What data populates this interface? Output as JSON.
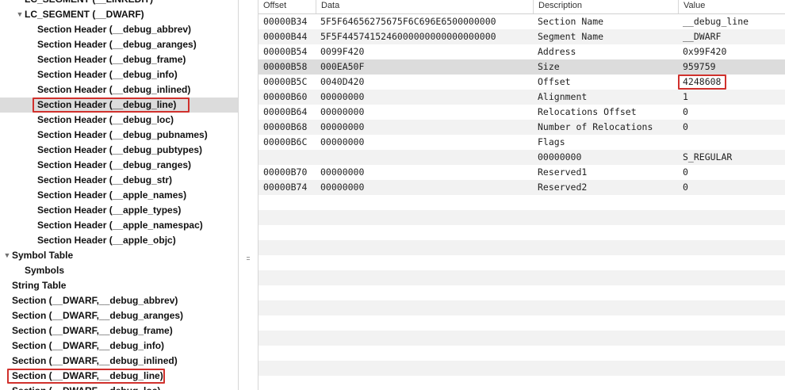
{
  "sidebar": {
    "items": [
      {
        "label": "LC_SEGMENT (__LINKEDIT)",
        "indent": 1,
        "disclosure": "none",
        "selected": false,
        "highlighted": false
      },
      {
        "label": "LC_SEGMENT (__DWARF)",
        "indent": 1,
        "disclosure": "expanded",
        "selected": false,
        "highlighted": false
      },
      {
        "label": "Section Header (__debug_abbrev)",
        "indent": 2,
        "disclosure": "none",
        "selected": false,
        "highlighted": false
      },
      {
        "label": "Section Header (__debug_aranges)",
        "indent": 2,
        "disclosure": "none",
        "selected": false,
        "highlighted": false
      },
      {
        "label": "Section Header (__debug_frame)",
        "indent": 2,
        "disclosure": "none",
        "selected": false,
        "highlighted": false
      },
      {
        "label": "Section Header (__debug_info)",
        "indent": 2,
        "disclosure": "none",
        "selected": false,
        "highlighted": false
      },
      {
        "label": "Section Header (__debug_inlined)",
        "indent": 2,
        "disclosure": "none",
        "selected": false,
        "highlighted": false
      },
      {
        "label": "Section Header (__debug_line)",
        "indent": 2,
        "disclosure": "none",
        "selected": true,
        "highlighted": true
      },
      {
        "label": "Section Header (__debug_loc)",
        "indent": 2,
        "disclosure": "none",
        "selected": false,
        "highlighted": false
      },
      {
        "label": "Section Header (__debug_pubnames)",
        "indent": 2,
        "disclosure": "none",
        "selected": false,
        "highlighted": false
      },
      {
        "label": "Section Header (__debug_pubtypes)",
        "indent": 2,
        "disclosure": "none",
        "selected": false,
        "highlighted": false
      },
      {
        "label": "Section Header (__debug_ranges)",
        "indent": 2,
        "disclosure": "none",
        "selected": false,
        "highlighted": false
      },
      {
        "label": "Section Header (__debug_str)",
        "indent": 2,
        "disclosure": "none",
        "selected": false,
        "highlighted": false
      },
      {
        "label": "Section Header (__apple_names)",
        "indent": 2,
        "disclosure": "none",
        "selected": false,
        "highlighted": false
      },
      {
        "label": "Section Header (__apple_types)",
        "indent": 2,
        "disclosure": "none",
        "selected": false,
        "highlighted": false
      },
      {
        "label": "Section Header (__apple_namespac)",
        "indent": 2,
        "disclosure": "none",
        "selected": false,
        "highlighted": false
      },
      {
        "label": "Section Header (__apple_objc)",
        "indent": 2,
        "disclosure": "none",
        "selected": false,
        "highlighted": false
      },
      {
        "label": "Symbol Table",
        "indent": 0,
        "disclosure": "expanded",
        "selected": false,
        "highlighted": false
      },
      {
        "label": "Symbols",
        "indent": 1,
        "disclosure": "none",
        "selected": false,
        "highlighted": false
      },
      {
        "label": "String Table",
        "indent": 0,
        "disclosure": "none",
        "selected": false,
        "highlighted": false
      },
      {
        "label": "Section (__DWARF,__debug_abbrev)",
        "indent": 0,
        "disclosure": "none",
        "selected": false,
        "highlighted": false
      },
      {
        "label": "Section (__DWARF,__debug_aranges)",
        "indent": 0,
        "disclosure": "none",
        "selected": false,
        "highlighted": false
      },
      {
        "label": "Section (__DWARF,__debug_frame)",
        "indent": 0,
        "disclosure": "none",
        "selected": false,
        "highlighted": false
      },
      {
        "label": "Section (__DWARF,__debug_info)",
        "indent": 0,
        "disclosure": "none",
        "selected": false,
        "highlighted": false
      },
      {
        "label": "Section (__DWARF,__debug_inlined)",
        "indent": 0,
        "disclosure": "none",
        "selected": false,
        "highlighted": false
      },
      {
        "label": "Section (__DWARF,__debug_line)",
        "indent": 0,
        "disclosure": "none",
        "selected": false,
        "highlighted": true
      },
      {
        "label": "Section (__DWARF,__debug_loc)",
        "indent": 0,
        "disclosure": "none",
        "selected": false,
        "highlighted": false
      }
    ]
  },
  "table": {
    "columns": [
      "Offset",
      "Data",
      "Description",
      "Value"
    ],
    "rows": [
      {
        "offset": "00000B34",
        "data": "5F5F64656275675F6C696E6500000000",
        "description": "Section Name",
        "value": "__debug_line",
        "selected": false,
        "highlighted": false
      },
      {
        "offset": "00000B44",
        "data": "5F5F4457415246000000000000000000",
        "description": "Segment Name",
        "value": "__DWARF",
        "selected": false,
        "highlighted": false
      },
      {
        "offset": "00000B54",
        "data": "0099F420",
        "description": "Address",
        "value": "0x99F420",
        "selected": false,
        "highlighted": false
      },
      {
        "offset": "00000B58",
        "data": "000EA50F",
        "description": "Size",
        "value": "959759",
        "selected": true,
        "highlighted": false
      },
      {
        "offset": "00000B5C",
        "data": "0040D420",
        "description": "Offset",
        "value": "4248608",
        "selected": false,
        "highlighted": true
      },
      {
        "offset": "00000B60",
        "data": "00000000",
        "description": "Alignment",
        "value": "1",
        "selected": false,
        "highlighted": false
      },
      {
        "offset": "00000B64",
        "data": "00000000",
        "description": "Relocations Offset",
        "value": "0",
        "selected": false,
        "highlighted": false
      },
      {
        "offset": "00000B68",
        "data": "00000000",
        "description": "Number of Relocations",
        "value": "0",
        "selected": false,
        "highlighted": false
      },
      {
        "offset": "00000B6C",
        "data": "00000000",
        "description": "Flags",
        "value": "",
        "selected": false,
        "highlighted": false
      },
      {
        "offset": "",
        "data": "",
        "description": "00000000",
        "value": "S_REGULAR",
        "selected": false,
        "highlighted": false
      },
      {
        "offset": "00000B70",
        "data": "00000000",
        "description": "Reserved1",
        "value": "0",
        "selected": false,
        "highlighted": false
      },
      {
        "offset": "00000B74",
        "data": "00000000",
        "description": "Reserved2",
        "value": "0",
        "selected": false,
        "highlighted": false
      }
    ],
    "empty_row_count": 13
  },
  "colors": {
    "highlight_border": "#d0312d",
    "selection": "#dcdcdc",
    "stripe": "#f2f2f2"
  }
}
